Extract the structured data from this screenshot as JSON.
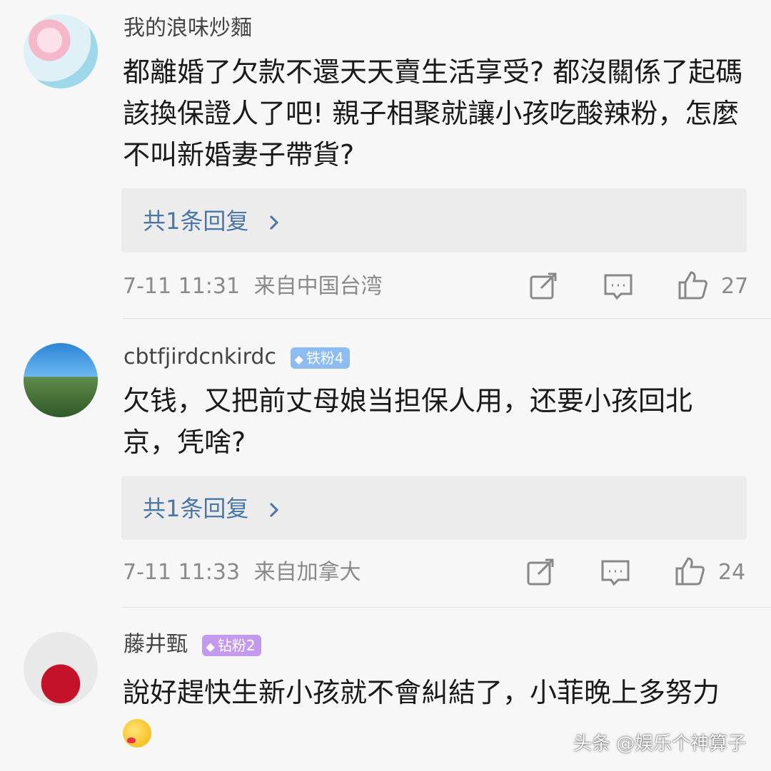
{
  "comments": [
    {
      "username": "我的浪味炒麵",
      "text": "都離婚了欠款不還天天賣生活享受? 都沒關係了起碼該換保證人了吧! 親子相聚就讓小孩吃酸辣粉，怎麼不叫新婚妻子帶貨?",
      "reply_label": "共1条回复",
      "time": "7-11 11:31",
      "location": "来自中国台湾",
      "likes": "27"
    },
    {
      "username": "cbtfjirdcnkirdc",
      "badge": "铁粉4",
      "text": "欠钱，又把前丈母娘当担保人用，还要小孩回北京，凭啥?",
      "reply_label": "共1条回复",
      "time": "7-11 11:33",
      "location": "来自加拿大",
      "likes": "24"
    },
    {
      "username": "藤井甄",
      "badge": "钻粉2",
      "text": "說好趕快生新小孩就不會糾結了，小菲晚上多努力"
    }
  ],
  "icons": {
    "share": "share-icon",
    "comment": "comment-icon",
    "like": "thumbs-up-icon",
    "reply_chevron": "chevron-right-icon",
    "badge_gem": "diamond-icon",
    "emoji": "kiss-emoji-icon"
  },
  "colors": {
    "reply_link": "#4a76a8",
    "badge_iron": "#8cbcf2",
    "badge_diamond": "#c49aef"
  },
  "watermark": "头条 @娱乐个神算子"
}
